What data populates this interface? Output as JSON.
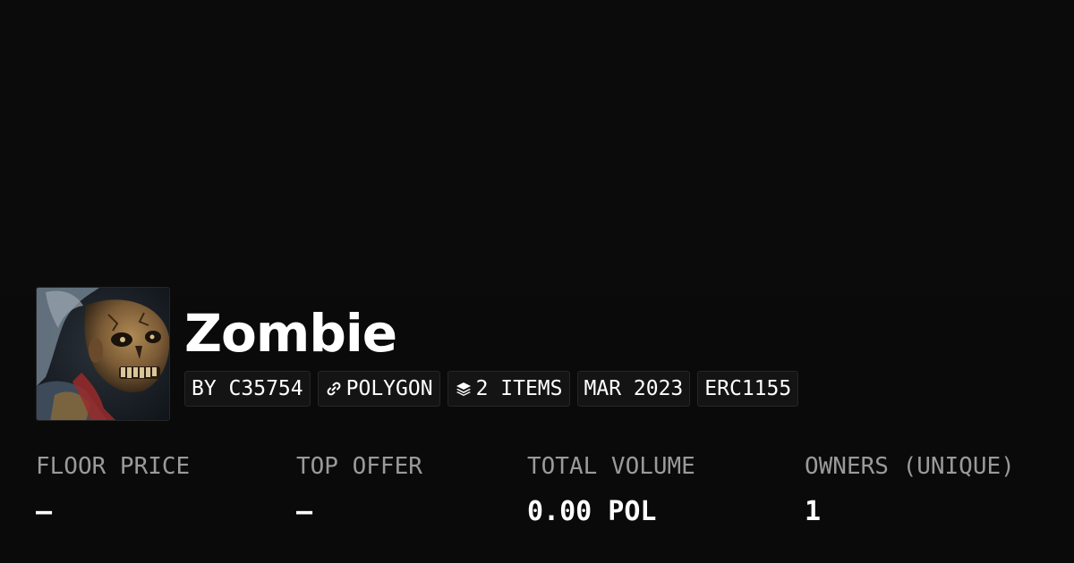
{
  "collection": {
    "name": "Zombie",
    "tags": {
      "creator": "BY C35754",
      "chain": "POLYGON",
      "chain_icon": "link-icon",
      "items": "2 ITEMS",
      "items_icon": "layers-icon",
      "date": "MAR 2023",
      "standard": "ERC1155"
    }
  },
  "stats": {
    "floor_price": {
      "label": "FLOOR PRICE",
      "value": "–"
    },
    "top_offer": {
      "label": "TOP OFFER",
      "value": "–"
    },
    "total_volume": {
      "label": "TOTAL VOLUME",
      "value": "0.00 POL"
    },
    "owners": {
      "label": "OWNERS (UNIQUE)",
      "value": "1"
    }
  },
  "colors": {
    "background": "#0a0a0a",
    "tag_background": "#141414",
    "tag_border": "#262626",
    "label": "#9a9a9a",
    "text": "#ffffff"
  }
}
